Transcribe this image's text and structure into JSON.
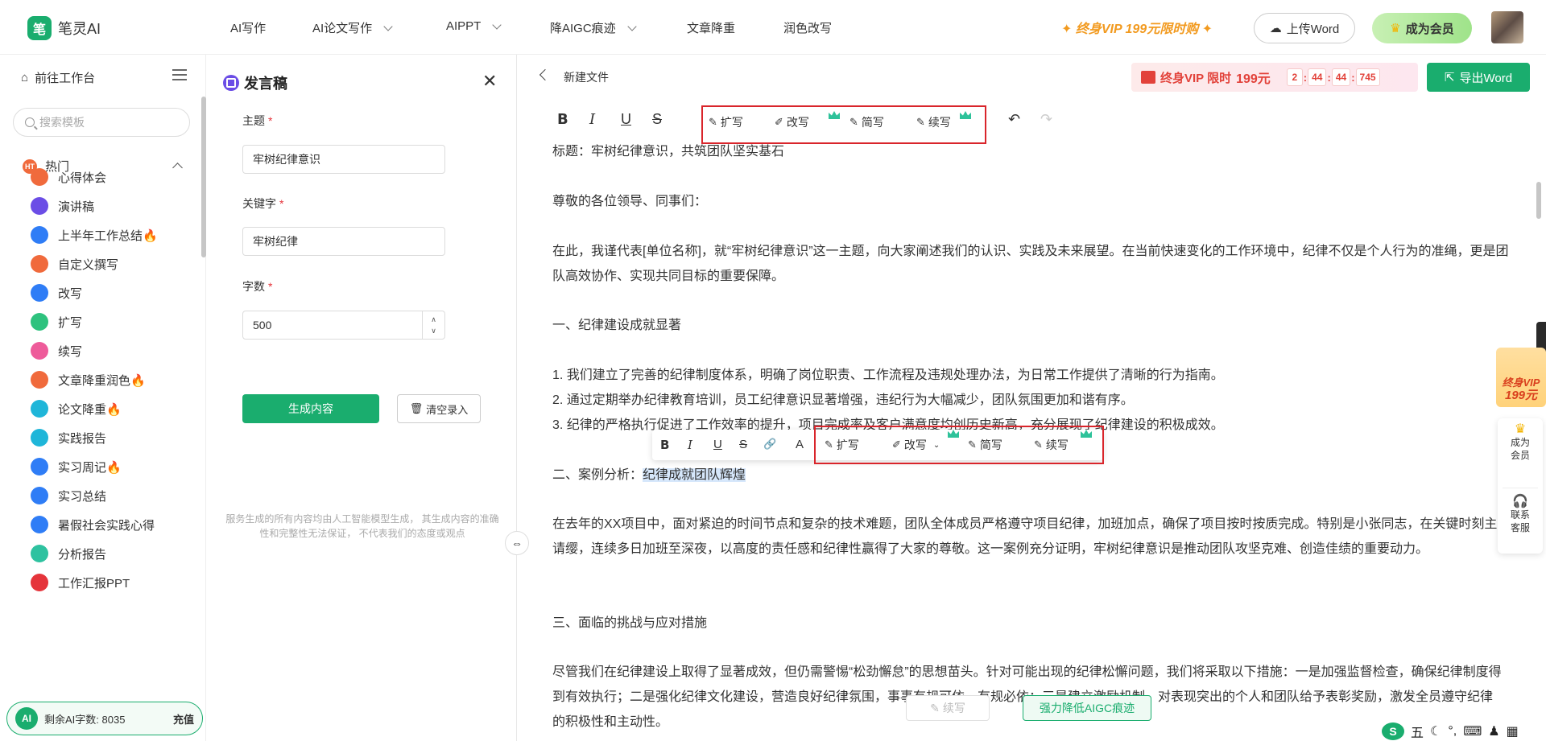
{
  "nav": {
    "logo_text": "笔灵AI",
    "logo_mark": "笔",
    "items": [
      {
        "label": "AI写作",
        "dropdown": false
      },
      {
        "label": "AI论文写作",
        "dropdown": true
      },
      {
        "label": "AIPPT",
        "dropdown": true
      },
      {
        "label": "降AIGC痕迹",
        "dropdown": true
      },
      {
        "label": "文章降重",
        "dropdown": false
      },
      {
        "label": "润色改写",
        "dropdown": false
      }
    ],
    "promo": "终身VIP 199元限时购",
    "upload_label": "上传Word",
    "member_label": "成为会员",
    "accent_color": "#1aad6e"
  },
  "sidebar": {
    "workbench_label": "前往工作台",
    "search_placeholder": "搜索模板",
    "section_label": "热门",
    "items": [
      {
        "label": "心得体会",
        "icon": "hot-icon",
        "color": "#f06a3c"
      },
      {
        "label": "演讲稿",
        "icon": "speech-icon",
        "color": "#6b4de6"
      },
      {
        "label": "上半年工作总结🔥",
        "icon": "briefcase-icon",
        "color": "#2f7df6"
      },
      {
        "label": "自定义撰写",
        "icon": "hot-icon",
        "color": "#f06a3c"
      },
      {
        "label": "改写",
        "icon": "wand-icon",
        "color": "#2f7df6"
      },
      {
        "label": "扩写",
        "icon": "expand-icon",
        "color": "#2ec27e"
      },
      {
        "label": "续写",
        "icon": "continue-icon",
        "color": "#ee5b9a"
      },
      {
        "label": "文章降重润色🔥",
        "icon": "hot-icon",
        "color": "#f06a3c"
      },
      {
        "label": "论文降重🔥",
        "icon": "paper-icon",
        "color": "#1fb6d9"
      },
      {
        "label": "实践报告",
        "icon": "report-icon",
        "color": "#1fb6d9"
      },
      {
        "label": "实习周记🔥",
        "icon": "calendar-icon",
        "color": "#2f7df6"
      },
      {
        "label": "实习总结",
        "icon": "calendar-icon",
        "color": "#2f7df6"
      },
      {
        "label": "暑假社会实践心得",
        "icon": "book-icon",
        "color": "#2f7df6"
      },
      {
        "label": "分析报告",
        "icon": "report-icon",
        "color": "#2ec2a0"
      },
      {
        "label": "工作汇报PPT",
        "icon": "ppt-icon",
        "color": "#e5343b"
      }
    ],
    "credit_avatar": "AI",
    "credit_text": "剩余AI字数: 8035",
    "credit_button": "充值"
  },
  "form": {
    "title": "发言稿",
    "topic_label": "主题",
    "topic_value": "牢树纪律意识",
    "keyword_label": "关键字",
    "keyword_value": "牢树纪律",
    "count_label": "字数",
    "count_value": "500",
    "generate_label": "生成内容",
    "clear_label": "清空录入",
    "disclaimer": "服务生成的所有内容均由人工智能模型生成， 其生成内容的准确性和完整性无法保证， 不代表我们的态度或观点"
  },
  "editor": {
    "file_title": "新建文件",
    "vip_label": "终身VIP 限时",
    "vip_price": "199元",
    "timer": [
      "2",
      "44",
      "44",
      "745"
    ],
    "export_label": "导出Word",
    "toolbar": {
      "bold": "B",
      "italic": "I",
      "underline": "U",
      "strike": "S",
      "expand": "扩写",
      "rewrite": "改写",
      "simplify": "简写",
      "continue": "续写",
      "undo": "↶",
      "redo": "↷"
    },
    "paragraphs": {
      "p0": "标题：牢树纪律意识，共筑团队坚实基石",
      "p1": "尊敬的各位领导、同事们：",
      "p2": "在此，我谨代表[单位名称]，就“牢树纪律意识”这一主题，向大家阐述我们的认识、实践及未来展望。在当前快速变化的工作环境中，纪律不仅是个人行为的准绳，更是团队高效协作、实现共同目标的重要保障。",
      "p3": "一、纪律建设成就显著",
      "p4": "1. 我们建立了完善的纪律制度体系，明确了岗位职责、工作流程及违规处理办法，为日常工作提供了清晰的行为指南。",
      "p5": "2. 通过定期举办纪律教育培训，员工纪律意识显著增强，违纪行为大幅减少，团队氛围更加和谐有序。",
      "p6": "3. 纪律的严格执行促进了工作效率的提升，项目完成率及客户满意度均创历史新高，充分展现了纪律建设的积极成效。",
      "p7_pre": "二、案例分析：",
      "p7_sel": "纪律成就团队辉煌",
      "p8": "在去年的XX项目中，面对紧迫的时间节点和复杂的技术难题，团队全体成员严格遵守项目纪律，加班加点，确保了项目按时按质完成。特别是小张同志，在关键时刻主动请缨，连续多日加班至深夜，以高度的责任感和纪律性赢得了大家的尊敬。这一案例充分证明，牢树纪律意识是推动团队攻坚克难、创造佳绩的重要动力。",
      "p9": "三、面临的挑战与应对措施",
      "p10": "尽管我们在纪律建设上取得了显著成效，但仍需警惕“松劲懈怠”的思想苗头。针对可能出现的纪律松懈问题，我们将采取以下措施：一是加强监督检查，确保纪律制度得到有效执行；二是强化纪律文化建设，营造良好纪律氛围，事事有规可依、有规必依；三是建立激励机制，对表现突出的个人和团队给予表彰奖励，激发全员遵守纪律的积极性和主动性。"
    },
    "float_toolbar": {
      "bold": "B",
      "italic": "I",
      "underline": "U",
      "strike": "S",
      "link": "🔗",
      "font": "A",
      "expand": "扩写",
      "rewrite": "改写",
      "simplify": "简写",
      "continue": "续写"
    },
    "bottom_rewrite": "续写",
    "bottom_reduce": "强力降低AIGC痕迹"
  },
  "right_widgets": {
    "vip_line1": "终身VIP",
    "vip_line2": "199元",
    "member": "成为会员",
    "service": "联系客服"
  },
  "ime": {
    "logo": "S",
    "mode": "五"
  },
  "colors": {
    "accent": "#1aad6e",
    "highlight": "#d9252b",
    "promo": "#f29a1f"
  }
}
